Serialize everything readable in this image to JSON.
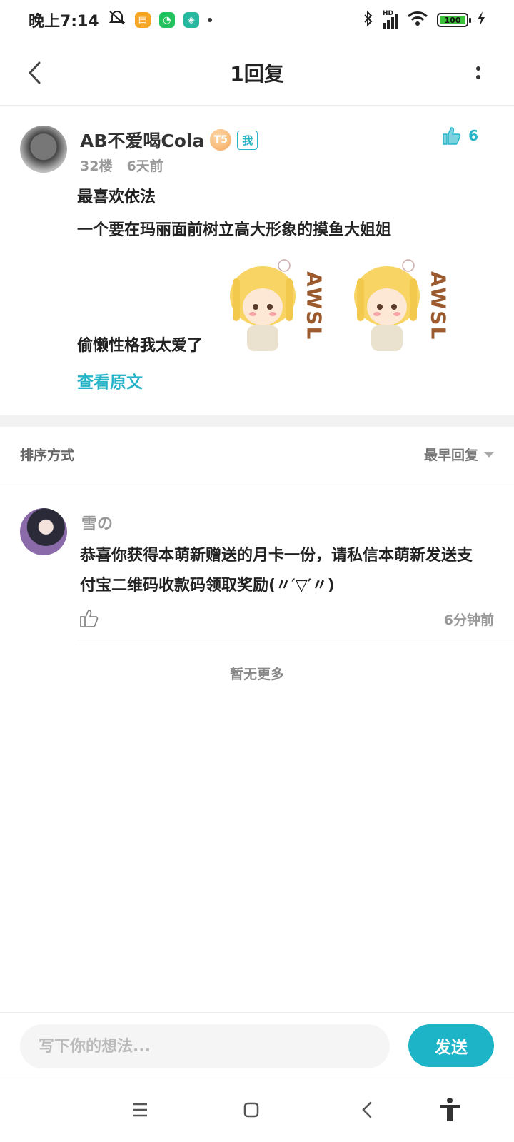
{
  "status_bar": {
    "time": "晚上7:14",
    "network_label": "HD",
    "battery_level": "100"
  },
  "header": {
    "title": "1回复"
  },
  "post": {
    "author": "AB不爱喝Cola",
    "level": "T5",
    "me_badge": "我",
    "like_count": "6",
    "floor": "32楼",
    "time": "6天前",
    "lines": [
      "最喜欢依法",
      "一个要在玛丽面前树立高大形象的摸鱼大姐姐",
      "偷懒性格我太爱了"
    ],
    "sticker_text": "AWSL",
    "view_original": "查看原文"
  },
  "sort": {
    "label": "排序方式",
    "selected": "最早回复"
  },
  "reply": {
    "author": "雪の",
    "text": "恭喜你获得本萌新赠送的月卡一份，请私信本萌新发送支付宝二维码收款码领取奖励(〃′▽′〃)",
    "time": "6分钟前"
  },
  "no_more": "暂无更多",
  "input": {
    "placeholder": "写下你的想法...",
    "send_label": "发送"
  },
  "colors": {
    "accent": "#1eb4c8",
    "like": "#28b4c8"
  }
}
